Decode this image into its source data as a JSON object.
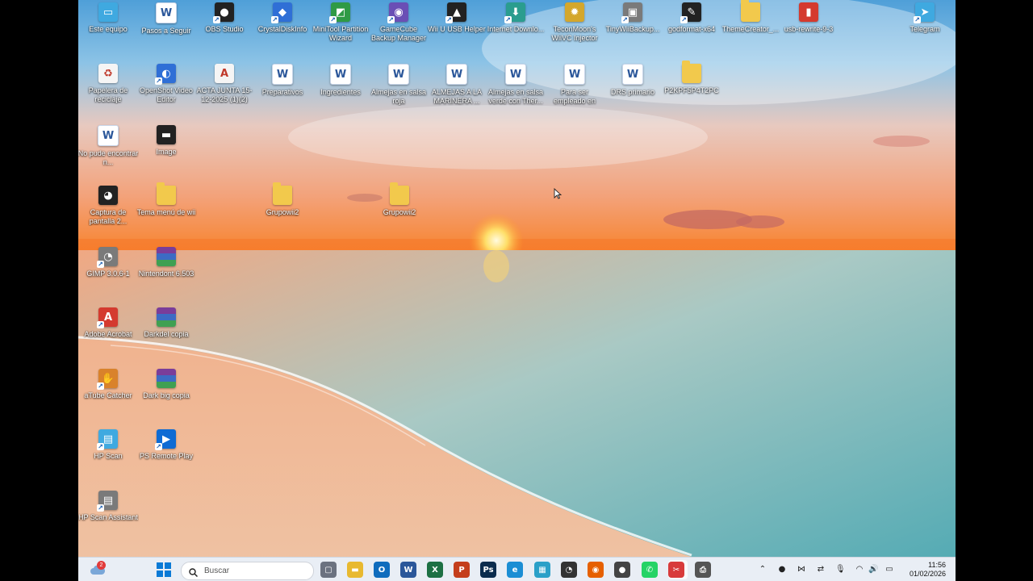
{
  "desktop": {
    "icons": [
      {
        "label": "Este equipo",
        "icon": "monitor-icon",
        "glyph": "▭",
        "color": "c-sky",
        "folder": false,
        "shortcut": false
      },
      {
        "label": "Pasos a Seguir",
        "icon": "word-document-icon",
        "glyph": "W",
        "color": "c-word",
        "folder": false,
        "shortcut": false
      },
      {
        "label": "OBS Studio",
        "icon": "obs-studio-icon",
        "glyph": "●",
        "color": "c-dark",
        "folder": false,
        "shortcut": true
      },
      {
        "label": "CrystalDiskInfo",
        "icon": "crystaldiskinfo-icon",
        "glyph": "◆",
        "color": "c-blue",
        "folder": false,
        "shortcut": true
      },
      {
        "label": "MiniTool Partition Wizard",
        "icon": "minitool-partition-icon",
        "glyph": "◩",
        "color": "c-green",
        "folder": false,
        "shortcut": true
      },
      {
        "label": "GameCube Backup Manager",
        "icon": "gamecube-backup-icon",
        "glyph": "◉",
        "color": "c-purple",
        "folder": false,
        "shortcut": true
      },
      {
        "label": "Wii U USB Helper",
        "icon": "wiiu-usb-helper-icon",
        "glyph": "▲",
        "color": "c-dark",
        "folder": false,
        "shortcut": true
      },
      {
        "label": "Internet Downlo...",
        "icon": "internet-download-manager-icon",
        "glyph": "⬇",
        "color": "c-teal",
        "folder": false,
        "shortcut": true
      },
      {
        "label": "TeconMoon's WiiVC Injector",
        "icon": "wiivc-injector-icon",
        "glyph": "✹",
        "color": "c-gold",
        "folder": false,
        "shortcut": false
      },
      {
        "label": "TinyWiiBackup...",
        "icon": "tinywiibackup-icon",
        "glyph": "▣",
        "color": "c-grey",
        "folder": false,
        "shortcut": true
      },
      {
        "label": "godformat-x64",
        "icon": "godformat-icon",
        "glyph": "✎",
        "color": "c-dark",
        "folder": false,
        "shortcut": true
      },
      {
        "label": "ThemeCreator_...",
        "icon": "folder-icon",
        "glyph": "",
        "color": "c-folder",
        "folder": true,
        "shortcut": false
      },
      {
        "label": "usb-rewrite-9-3",
        "icon": "usb-rewrite-icon",
        "glyph": "▮",
        "color": "c-red",
        "folder": false,
        "shortcut": false
      },
      {
        "label": "Telegram",
        "icon": "telegram-icon",
        "glyph": "➤",
        "color": "c-sky",
        "folder": false,
        "shortcut": true
      },
      {
        "label": "Papelera de reciclaje",
        "icon": "recycle-bin-icon",
        "glyph": "♻",
        "color": "c-white",
        "folder": false,
        "shortcut": false
      },
      {
        "label": "OpenShot Video Editor",
        "icon": "openshot-icon",
        "glyph": "◐",
        "color": "c-blue",
        "folder": false,
        "shortcut": true
      },
      {
        "label": "ACTA JUNTA 15-12-2025 (1)(2)",
        "icon": "pdf-document-icon",
        "glyph": "A",
        "color": "c-white",
        "folder": false,
        "shortcut": false
      },
      {
        "label": "Preparativos",
        "icon": "word-document-icon",
        "glyph": "W",
        "color": "c-word",
        "folder": false,
        "shortcut": false
      },
      {
        "label": "Ingredientes",
        "icon": "word-document-icon",
        "glyph": "W",
        "color": "c-word",
        "folder": false,
        "shortcut": false
      },
      {
        "label": "Almejas en salsa roja",
        "icon": "word-document-icon",
        "glyph": "W",
        "color": "c-word",
        "folder": false,
        "shortcut": false
      },
      {
        "label": "ALMEJAS A LA MARINERA ...",
        "icon": "word-document-icon",
        "glyph": "W",
        "color": "c-word",
        "folder": false,
        "shortcut": false
      },
      {
        "label": "Almejas en salsa verde con Ther...",
        "icon": "word-document-icon",
        "glyph": "W",
        "color": "c-word",
        "folder": false,
        "shortcut": false
      },
      {
        "label": "Para ser empleado en nuestro curs...",
        "icon": "word-document-icon",
        "glyph": "W",
        "color": "c-word",
        "folder": false,
        "shortcut": false
      },
      {
        "label": "DRS primario",
        "icon": "word-document-icon",
        "glyph": "W",
        "color": "c-word",
        "folder": false,
        "shortcut": false
      },
      {
        "label": "P2KPF5P4T2PC",
        "icon": "folder-icon",
        "glyph": "",
        "color": "c-folder",
        "folder": true,
        "shortcut": false
      },
      {
        "label": "No pude encontrar n...",
        "icon": "word-document-icon",
        "glyph": "W",
        "color": "c-word",
        "folder": false,
        "shortcut": false
      },
      {
        "label": "Image",
        "icon": "image-file-icon",
        "glyph": "▬",
        "color": "c-dark",
        "folder": false,
        "shortcut": false
      },
      {
        "label": "Captura de pantalla 2...",
        "icon": "screenshot-file-icon",
        "glyph": "◕",
        "color": "c-dark",
        "folder": false,
        "shortcut": false
      },
      {
        "label": "Tema menú de wii",
        "icon": "folder-icon",
        "glyph": "",
        "color": "c-folder",
        "folder": true,
        "shortcut": false
      },
      {
        "label": "Grupowii2",
        "icon": "folder-icon",
        "glyph": "",
        "color": "c-folder",
        "folder": true,
        "shortcut": false
      },
      {
        "label": "Grupowii2",
        "icon": "folder-icon",
        "glyph": "",
        "color": "c-folder",
        "folder": true,
        "shortcut": false
      },
      {
        "label": "GIMP 3.0.6-1",
        "icon": "gimp-icon",
        "glyph": "◔",
        "color": "c-grey",
        "folder": false,
        "shortcut": true
      },
      {
        "label": "Nintendont 6.503",
        "icon": "winrar-archive-icon",
        "glyph": "",
        "color": "c-rar",
        "folder": false,
        "shortcut": false
      },
      {
        "label": "Adobe Acrobat",
        "icon": "adobe-acrobat-icon",
        "glyph": "A",
        "color": "c-red",
        "folder": false,
        "shortcut": true
      },
      {
        "label": "Darkdel copia",
        "icon": "winrar-archive-icon",
        "glyph": "",
        "color": "c-rar",
        "folder": false,
        "shortcut": false
      },
      {
        "label": "aTube Catcher",
        "icon": "atube-catcher-icon",
        "glyph": "✋",
        "color": "c-orange",
        "folder": false,
        "shortcut": true
      },
      {
        "label": "Dark big copia",
        "icon": "winrar-archive-icon",
        "glyph": "",
        "color": "c-rar",
        "folder": false,
        "shortcut": false
      },
      {
        "label": "HP Scan",
        "icon": "hp-scan-icon",
        "glyph": "▤",
        "color": "c-sky",
        "folder": false,
        "shortcut": true
      },
      {
        "label": "PS Remote Play",
        "icon": "ps-remote-play-icon",
        "glyph": "▶",
        "color": "c-ps",
        "folder": false,
        "shortcut": true
      },
      {
        "label": "HP Scan Assistant",
        "icon": "hp-scan-assistant-icon",
        "glyph": "▤",
        "color": "c-grey",
        "folder": false,
        "shortcut": true
      }
    ]
  },
  "taskbar": {
    "weather_badge": "2",
    "search_placeholder": "Buscar",
    "apps": [
      {
        "name": "task-view-icon",
        "glyph": "▢",
        "color": "#6b7280"
      },
      {
        "name": "file-explorer-icon",
        "glyph": "▬",
        "color": "#e8b930"
      },
      {
        "name": "outlook-icon",
        "glyph": "O",
        "color": "#0f6cbd"
      },
      {
        "name": "word-icon",
        "glyph": "W",
        "color": "#2b579a"
      },
      {
        "name": "excel-icon",
        "glyph": "X",
        "color": "#1d7044"
      },
      {
        "name": "powerpoint-icon",
        "glyph": "P",
        "color": "#c43e1c"
      },
      {
        "name": "photoshop-icon",
        "glyph": "Ps",
        "color": "#0b2c4d"
      },
      {
        "name": "edge-icon",
        "glyph": "e",
        "color": "#1b8ed4"
      },
      {
        "name": "calculator-app-icon",
        "glyph": "▦",
        "color": "#2aa0c8"
      },
      {
        "name": "speedometer-app-icon",
        "glyph": "◔",
        "color": "#333"
      },
      {
        "name": "firefox-icon",
        "glyph": "◉",
        "color": "#e66000"
      },
      {
        "name": "obs-studio-icon",
        "glyph": "●",
        "color": "#444"
      },
      {
        "name": "whatsapp-icon",
        "glyph": "✆",
        "color": "#25d366"
      },
      {
        "name": "snipping-tool-icon",
        "glyph": "✂",
        "color": "#d83b3b"
      },
      {
        "name": "printer-app-icon",
        "glyph": "⎙",
        "color": "#555"
      }
    ],
    "tray": [
      {
        "name": "show-hidden-icons-chevron",
        "glyph": "⌃"
      },
      {
        "name": "recording-app-tray-icon",
        "glyph": "●"
      },
      {
        "name": "equalizer-tray-icon",
        "glyph": "⋈"
      },
      {
        "name": "sync-tray-icon",
        "glyph": "⇄"
      },
      {
        "name": "microphone-icon",
        "glyph": "🎙"
      },
      {
        "name": "wifi-icon",
        "glyph": "◠"
      },
      {
        "name": "volume-icon",
        "glyph": "🔊"
      },
      {
        "name": "battery-icon",
        "glyph": "▭"
      }
    ],
    "clock": {
      "time": "11:56",
      "date": "01/02/2026"
    }
  }
}
